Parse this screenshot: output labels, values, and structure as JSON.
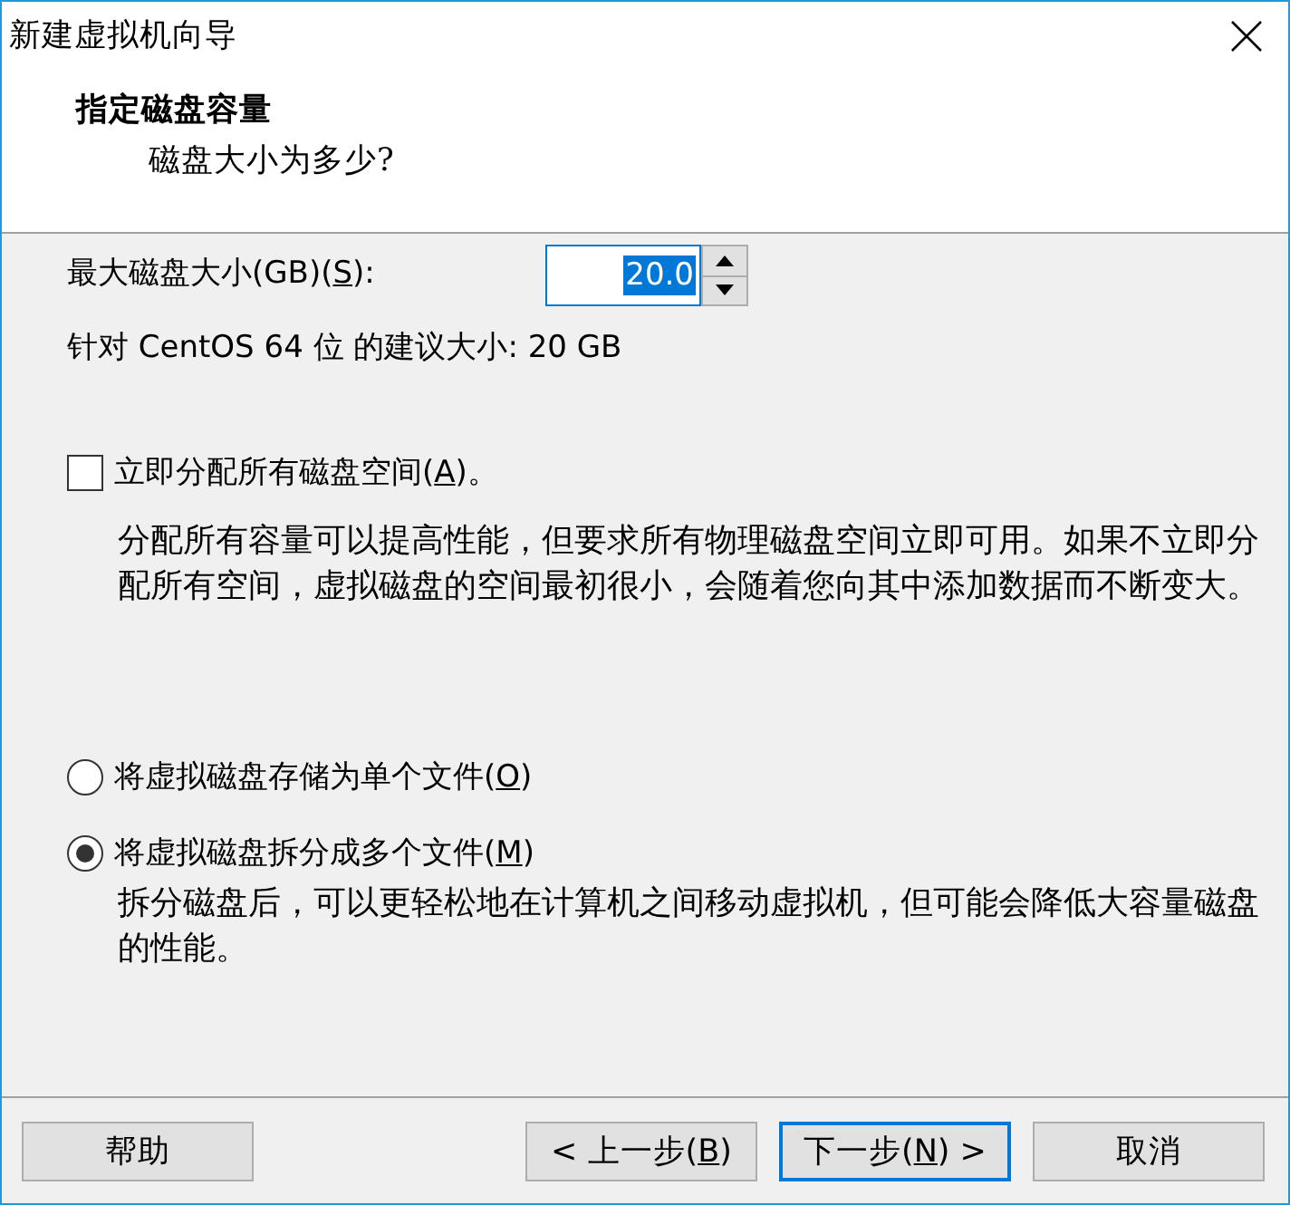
{
  "window": {
    "title": "新建虚拟机向导"
  },
  "header": {
    "title": "指定磁盘容量",
    "subtitle": "磁盘大小为多少?"
  },
  "disk_size": {
    "label": [
      {
        "text": "最大磁盘大小(GB)(",
        "underlined": false
      },
      {
        "text": "S",
        "underlined": true
      },
      {
        "text": "):",
        "underlined": false
      }
    ],
    "value": "20.0",
    "value_selected": true
  },
  "recommendation": "针对 CentOS 64 位 的建议大小: 20 GB",
  "allocate": {
    "label": [
      {
        "text": "立即分配所有磁盘空间(",
        "underlined": false
      },
      {
        "text": "A",
        "underlined": true
      },
      {
        "text": ")。",
        "underlined": false
      }
    ],
    "checked": false,
    "description": "分配所有容量可以提高性能，但要求所有物理磁盘空间立即可用。如果不立即分配所有空间，虚拟磁盘的空间最初很小，会随着您向其中添加数据而不断变大。"
  },
  "storage_options": [
    {
      "label": [
        {
          "text": "将虚拟磁盘存储为单个文件(",
          "underlined": false
        },
        {
          "text": "O",
          "underlined": true
        },
        {
          "text": ")",
          "underlined": false
        }
      ],
      "selected": false
    },
    {
      "label": [
        {
          "text": "将虚拟磁盘拆分成多个文件(",
          "underlined": false
        },
        {
          "text": "M",
          "underlined": true
        },
        {
          "text": ")",
          "underlined": false
        }
      ],
      "selected": true,
      "description": "拆分磁盘后，可以更轻松地在计算机之间移动虚拟机，但可能会降低大容量磁盘的性能。"
    }
  ],
  "buttons": [
    {
      "label": [
        {
          "text": "帮助",
          "underlined": false
        }
      ],
      "default": false
    },
    {
      "label": [
        {
          "text": "< 上一步(",
          "underlined": false
        },
        {
          "text": "B",
          "underlined": true
        },
        {
          "text": ")",
          "underlined": false
        }
      ],
      "default": false
    },
    {
      "label": [
        {
          "text": "下一步(",
          "underlined": false
        },
        {
          "text": "N",
          "underlined": true
        },
        {
          "text": ") >",
          "underlined": false
        }
      ],
      "default": true
    },
    {
      "label": [
        {
          "text": "取消",
          "underlined": false
        }
      ],
      "default": false
    }
  ]
}
